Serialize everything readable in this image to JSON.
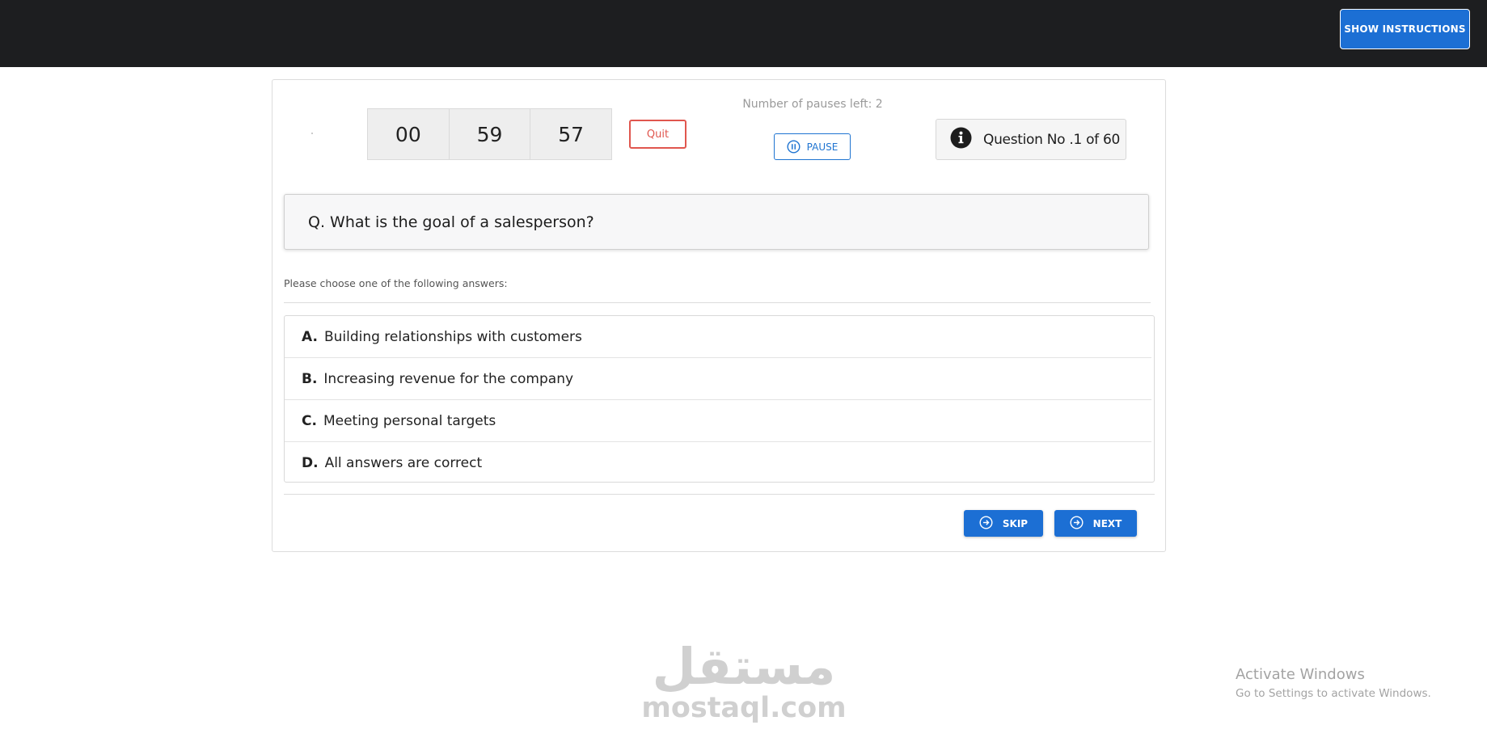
{
  "header": {
    "instructions_button": "SHOW INSTRUCTIONS"
  },
  "timer": {
    "hours": "00",
    "minutes": "59",
    "seconds": "57"
  },
  "controls": {
    "quit_label": "Quit",
    "pauses_left_text": "Number of pauses left: 2",
    "pause_label": "PAUSE"
  },
  "question_counter": {
    "label": "Question No .1 of 60"
  },
  "question": {
    "text": "Q. What is the goal of a salesperson?",
    "instruction": "Please choose one of the following answers:",
    "answers": [
      {
        "letter": "A.",
        "text": "Building relationships with customers"
      },
      {
        "letter": "B.",
        "text": "Increasing revenue for the company"
      },
      {
        "letter": "C.",
        "text": "Meeting personal targets"
      },
      {
        "letter": "D.",
        "text": "All answers are correct"
      }
    ]
  },
  "actions": {
    "skip_label": "SKIP",
    "next_label": "NEXT"
  },
  "watermark": {
    "arabic": "مستقل",
    "latin": "mostaql.com"
  },
  "os_notice": {
    "title": "Activate Windows",
    "subtitle": "Go to Settings to activate Windows."
  },
  "colors": {
    "topbar": "#1d1e20",
    "primary": "#1c6fd4",
    "quit": "#e0564e"
  }
}
